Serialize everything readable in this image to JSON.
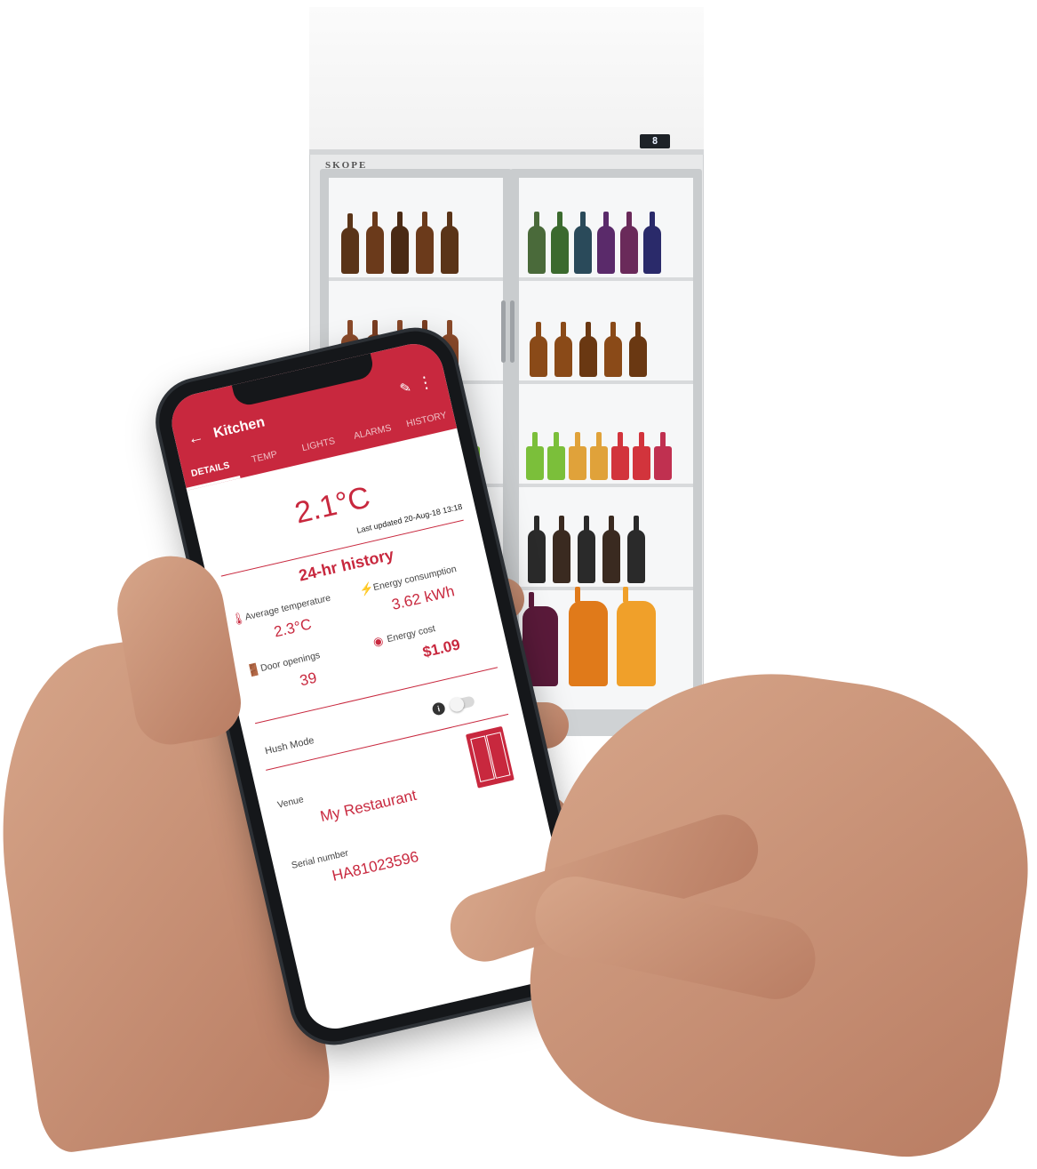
{
  "fridge": {
    "brand": "SKOPE",
    "display_reading": "8"
  },
  "app": {
    "title": "Kitchen",
    "tabs": [
      "DETAILS",
      "TEMP",
      "LIGHTS",
      "ALARMS",
      "HISTORY"
    ],
    "active_tab": "DETAILS",
    "accent_color": "#c8283e"
  },
  "details": {
    "current_temp": "2.1°C",
    "last_updated_label": "Last updated",
    "last_updated_value": "20-Aug-18 13:18",
    "history_title": "24-hr history",
    "avg_temp_label": "Average temperature",
    "avg_temp_value": "2.3°C",
    "energy_label": "Energy consumption",
    "energy_value": "3.62 kWh",
    "door_label": "Door openings",
    "door_value": "39",
    "cost_label": "Energy cost",
    "cost_value": "$1.09",
    "hush_label": "Hush Mode",
    "venue_label": "Venue",
    "venue_value": "My Restaurant",
    "serial_label": "Serial number",
    "serial_value": "HA81023596"
  }
}
